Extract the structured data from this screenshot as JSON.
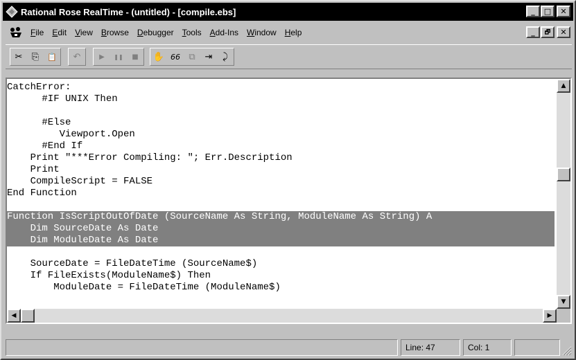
{
  "window": {
    "title": "Rational Rose RealTime - (untitled) - [compile.ebs]",
    "minimize_glyph": "_",
    "maximize_glyph": "□",
    "close_glyph": "✕"
  },
  "menubar": {
    "items": [
      {
        "pre": "",
        "ul": "F",
        "post": "ile"
      },
      {
        "pre": "",
        "ul": "E",
        "post": "dit"
      },
      {
        "pre": "",
        "ul": "V",
        "post": "iew"
      },
      {
        "pre": "",
        "ul": "B",
        "post": "rowse"
      },
      {
        "pre": "",
        "ul": "D",
        "post": "ebugger"
      },
      {
        "pre": "",
        "ul": "T",
        "post": "ools"
      },
      {
        "pre": "",
        "ul": "A",
        "post": "dd-Ins"
      },
      {
        "pre": "",
        "ul": "W",
        "post": "indow"
      },
      {
        "pre": "",
        "ul": "H",
        "post": "elp"
      }
    ],
    "mdi_minimize": "_",
    "mdi_restore": "🗗",
    "mdi_close": "✕"
  },
  "toolbar": {
    "cut_icon": "✂",
    "copy_icon": "⎘",
    "paste_icon": "📋",
    "undo_icon": "↶",
    "run_icon": "▶",
    "pause_icon": "❚❚",
    "stop_icon": "■",
    "hand_icon": "✋",
    "watch_icon": "66",
    "calls_icon": "⧉",
    "step_into_icon": "⇥",
    "step_over_icon": "⤸"
  },
  "editor": {
    "lines": [
      {
        "text": "CatchError:",
        "sel": false
      },
      {
        "text": "      #IF UNIX Then",
        "sel": false
      },
      {
        "text": "",
        "sel": false
      },
      {
        "text": "      #Else",
        "sel": false
      },
      {
        "text": "         Viewport.Open",
        "sel": false
      },
      {
        "text": "      #End If",
        "sel": false
      },
      {
        "text": "    Print \"***Error Compiling: \"; Err.Description",
        "sel": false
      },
      {
        "text": "    Print",
        "sel": false
      },
      {
        "text": "    CompileScript = FALSE",
        "sel": false
      },
      {
        "text": "End Function",
        "sel": false
      },
      {
        "text": "",
        "sel": false
      },
      {
        "text": "Function IsScriptOutOfDate (SourceName As String, ModuleName As String) A",
        "sel": true
      },
      {
        "text": "    Dim SourceDate As Date",
        "sel": true
      },
      {
        "text": "    Dim ModuleDate As Date",
        "sel": true
      },
      {
        "text": "",
        "sel": false
      },
      {
        "text": "    SourceDate = FileDateTime (SourceName$)",
        "sel": false
      },
      {
        "text": "    If FileExists(ModuleName$) Then",
        "sel": false
      },
      {
        "text": "        ModuleDate = FileDateTime (ModuleName$)",
        "sel": false
      }
    ]
  },
  "scroll": {
    "up": "▲",
    "down": "▼",
    "left": "◀",
    "right": "▶"
  },
  "status": {
    "line": "Line: 47",
    "col": "Col: 1"
  }
}
